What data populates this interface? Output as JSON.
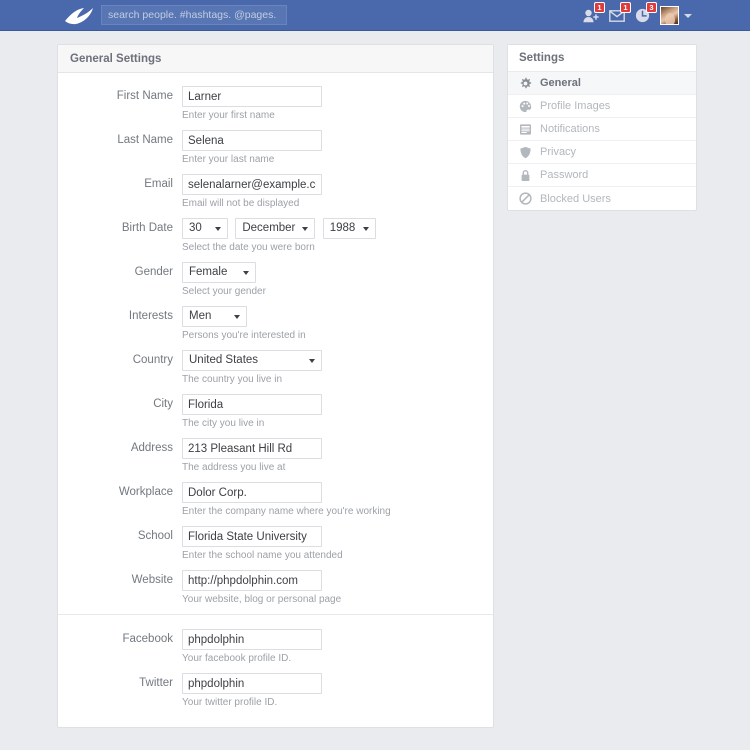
{
  "topbar": {
    "logo_icon": "dolphin-logo",
    "search": {
      "placeholder": "search people. #hashtags. @pages. !groups",
      "value": ""
    },
    "nav_icons": [
      {
        "icon": "friend-requests-icon",
        "badge": "1"
      },
      {
        "icon": "messages-icon",
        "badge": "1"
      },
      {
        "icon": "notifications-icon",
        "badge": "3"
      }
    ],
    "avatar": {
      "icon": "user-avatar",
      "caret": "chevron-down-icon"
    },
    "colors": {
      "bar": "#4a69ad",
      "badge": "#e03a3a"
    }
  },
  "main_panel": {
    "title": "General Settings",
    "fields": [
      {
        "label": "First Name",
        "type": "text",
        "value": "Larner",
        "help": "Enter your first name"
      },
      {
        "label": "Last Name",
        "type": "text",
        "value": "Selena",
        "help": "Enter your last name"
      },
      {
        "label": "Email",
        "type": "text",
        "value": "selenalarner@example.com",
        "help": "Email will not be displayed"
      },
      {
        "label": "Birth Date",
        "type": "date",
        "day": "30",
        "month": "December",
        "year": "1988",
        "help": "Select the date you were born"
      },
      {
        "label": "Gender",
        "type": "select",
        "value": "Female",
        "help": "Select your gender"
      },
      {
        "label": "Interests",
        "type": "select",
        "value": "Men",
        "help": "Persons you're interested in"
      },
      {
        "label": "Country",
        "type": "select",
        "value": "United States",
        "help": "The country you live in"
      },
      {
        "label": "City",
        "type": "text",
        "value": "Florida",
        "help": "The city you live in"
      },
      {
        "label": "Address",
        "type": "text",
        "value": "213 Pleasant Hill Rd",
        "help": "The address you live at"
      },
      {
        "label": "Workplace",
        "type": "text",
        "value": "Dolor Corp.",
        "help": "Enter the company name where you're working"
      },
      {
        "label": "School",
        "type": "text",
        "value": "Florida State University",
        "help": "Enter the school name you attended"
      },
      {
        "label": "Website",
        "type": "text",
        "value": "http://phpdolphin.com",
        "help": "Your website, blog or personal page"
      }
    ],
    "social_fields": [
      {
        "label": "Facebook",
        "type": "text",
        "value": "phpdolphin",
        "help": "Your facebook profile ID."
      },
      {
        "label": "Twitter",
        "type": "text",
        "value": "phpdolphin",
        "help": "Your twitter profile ID."
      }
    ]
  },
  "settings_panel": {
    "title": "Settings",
    "items": [
      {
        "label": "General",
        "icon": "gear-icon",
        "active": true
      },
      {
        "label": "Profile Images",
        "icon": "palette-icon",
        "active": false
      },
      {
        "label": "Notifications",
        "icon": "list-document-icon",
        "active": false
      },
      {
        "label": "Privacy",
        "icon": "shield-icon",
        "active": false
      },
      {
        "label": "Password",
        "icon": "lock-icon",
        "active": false
      },
      {
        "label": "Blocked Users",
        "icon": "ban-circle-icon",
        "active": false
      }
    ]
  }
}
